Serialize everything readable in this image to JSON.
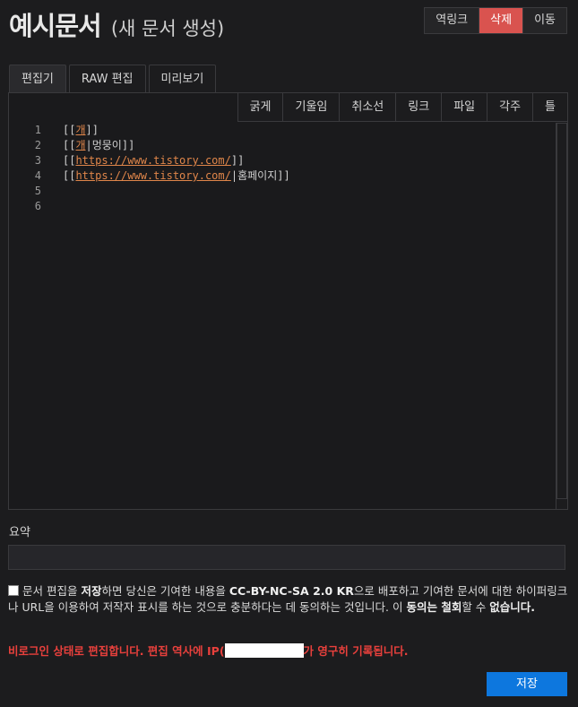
{
  "header": {
    "title": "예시문서",
    "subtitle": "(새 문서 생성)",
    "actions": [
      "역링크",
      "삭제",
      "이동"
    ]
  },
  "tabs": [
    "편집기",
    "RAW 편집",
    "미리보기"
  ],
  "toolbar": [
    "굵게",
    "기울임",
    "취소선",
    "링크",
    "파일",
    "각주",
    "틀"
  ],
  "editor": {
    "lines": [
      {
        "num": "1",
        "pre": "[[",
        "link": "개",
        "post": "]]"
      },
      {
        "num": "2",
        "pre": "[[",
        "link": "개",
        "post": "|멍뭉이]]"
      },
      {
        "num": "3",
        "pre": "[[",
        "link": "https://www.tistory.com/",
        "post": "]]"
      },
      {
        "num": "4",
        "pre": "[[",
        "link": "https://www.tistory.com/",
        "post": "|홈페이지]]"
      },
      {
        "num": "5",
        "pre": "",
        "link": "",
        "post": ""
      },
      {
        "num": "6",
        "pre": "",
        "link": "",
        "post": ""
      }
    ]
  },
  "summary": {
    "label": "요약",
    "value": ""
  },
  "agreement": {
    "t1": "문서 편집을 ",
    "b1": "저장",
    "t2": "하면 당신은 기여한 내용을 ",
    "b2": "CC-BY-NC-SA 2.0 KR",
    "t3": "으로 배포하고 기여한 문서에 대한 하이퍼링크나 URL을 이용하여 저작자 표시를 하는 것으로 충분하다는 데 동의하는 것입니다. 이 ",
    "b3": "동의는 철회",
    "t4": "할 수 ",
    "b4": "없습니다."
  },
  "warning": {
    "before": "비로그인 상태로 편집합니다. 편집 역사에 IP(",
    "after": "가 영구히 기록됩니다."
  },
  "save_label": "저장",
  "colors": {
    "danger": "#d9534f",
    "primary": "#0d77de",
    "warning": "#e8403c",
    "link": "#e0864a"
  }
}
